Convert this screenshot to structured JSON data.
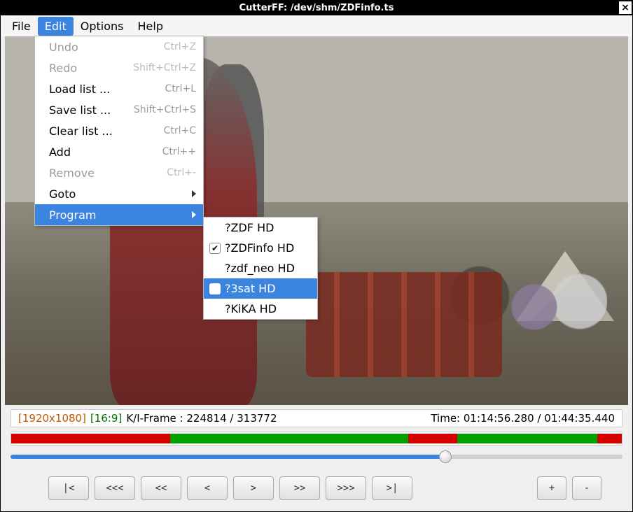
{
  "titlebar": {
    "text": "CutterFF: /dev/shm/ZDFinfo.ts",
    "close": "×"
  },
  "menubar": {
    "file": "File",
    "edit": "Edit",
    "options": "Options",
    "help": "Help"
  },
  "edit_menu": [
    {
      "label": "Undo",
      "shortcut": "Ctrl+Z",
      "disabled": true
    },
    {
      "label": "Redo",
      "shortcut": "Shift+Ctrl+Z",
      "disabled": true
    },
    {
      "label": "Load list ...",
      "shortcut": "Ctrl+L"
    },
    {
      "label": "Save list ...",
      "shortcut": "Shift+Ctrl+S"
    },
    {
      "label": "Clear list ...",
      "shortcut": "Ctrl+C"
    },
    {
      "label": "Add",
      "shortcut": "Ctrl++"
    },
    {
      "label": "Remove",
      "shortcut": "Ctrl+-",
      "disabled": true
    },
    {
      "label": "Goto",
      "submenu": true
    },
    {
      "label": "Program",
      "submenu": true,
      "active": true
    }
  ],
  "program_submenu": [
    {
      "label": "?ZDF HD",
      "checked": false
    },
    {
      "label": "?ZDFinfo HD",
      "checked": true
    },
    {
      "label": "?zdf_neo HD",
      "checked": false
    },
    {
      "label": "?3sat HD",
      "checked": false,
      "active": true
    },
    {
      "label": "?KiKA HD",
      "checked": false
    }
  ],
  "status": {
    "resolution": "[1920x1080]",
    "aspect": "[16:9]",
    "frame": "K/I-Frame : 224814 / 313772",
    "time": "Time: 01:14:56.280 / 01:44:35.440"
  },
  "nav_buttons": [
    "|<",
    "<<<",
    "<<",
    "<",
    ">",
    ">>",
    ">>>",
    ">|"
  ],
  "pm_buttons": [
    "+",
    "-"
  ]
}
